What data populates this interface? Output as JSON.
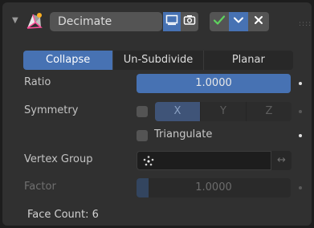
{
  "header": {
    "modifier_name": "Decimate",
    "icons": [
      "collapse-arrow-icon",
      "decimate-modifier-icon",
      "edit-mode-display-icon",
      "render-camera-icon",
      "apply-check-icon",
      "dropdown-chevron-icon",
      "close-icon",
      "drag-grip-icon"
    ],
    "collapse_glyph": "▼",
    "grip_glyph": "::::"
  },
  "mode_tabs": [
    {
      "label": "Collapse",
      "active": true
    },
    {
      "label": "Un-Subdivide",
      "active": false
    },
    {
      "label": "Planar",
      "active": false
    }
  ],
  "ratio": {
    "label": "Ratio",
    "value": "1.0000"
  },
  "symmetry": {
    "label": "Symmetry",
    "checked": false,
    "axes": [
      {
        "label": "X",
        "active": true
      },
      {
        "label": "Y",
        "active": false
      },
      {
        "label": "Z",
        "active": false
      }
    ]
  },
  "triangulate": {
    "label": "Triangulate",
    "checked": false
  },
  "vertex_group": {
    "label": "Vertex Group",
    "value": "",
    "invert_glyph": "↔"
  },
  "factor": {
    "label": "Factor",
    "value": "1.0000",
    "enabled": false,
    "fill": 0.08
  },
  "face_count": "Face Count: 6",
  "colors": {
    "accent": "#4772b3",
    "panel": "#303030",
    "background": "#1d1d1d",
    "apply_green": "#5ed35e"
  }
}
